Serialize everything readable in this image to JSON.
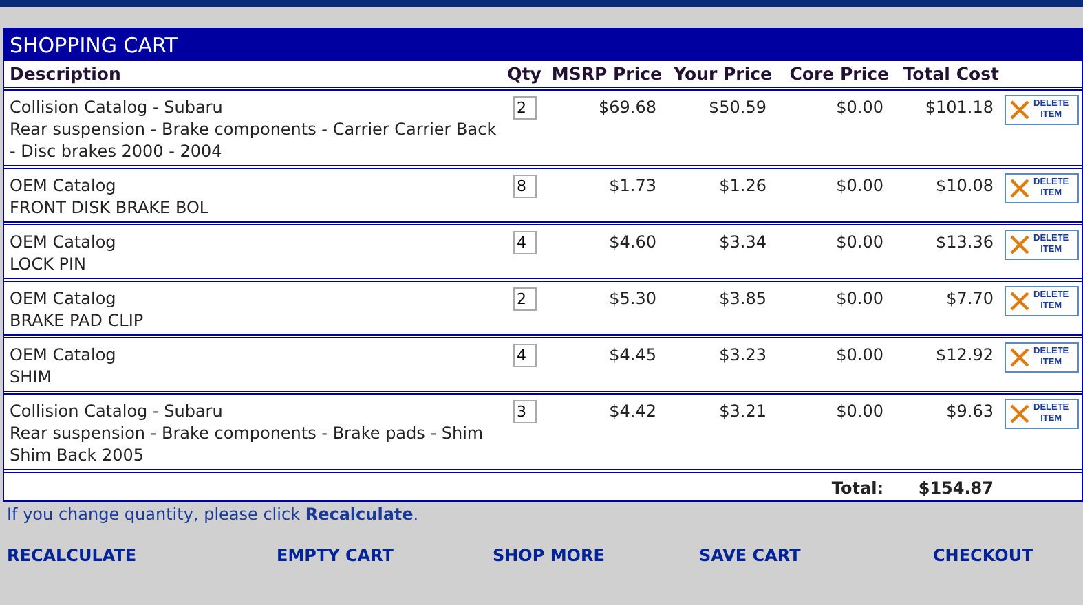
{
  "cart": {
    "title": "SHOPPING CART",
    "columns": [
      "Description",
      "Qty",
      "MSRP Price",
      "Your Price",
      "Core Price",
      "Total Cost"
    ],
    "rows": [
      {
        "description": [
          "Collision Catalog - Subaru",
          "Rear suspension - Brake components - Carrier Carrier Back - Disc brakes 2000 - 2004"
        ],
        "qty": "2",
        "msrp": "$69.68",
        "your_price": "$50.59",
        "core": "$0.00",
        "total": "$101.18",
        "delete": [
          "DELETE",
          "ITEM"
        ]
      },
      {
        "description": [
          "OEM Catalog",
          "FRONT DISK BRAKE BOL"
        ],
        "qty": "8",
        "msrp": "$1.73",
        "your_price": "$1.26",
        "core": "$0.00",
        "total": "$10.08",
        "delete": [
          "DELETE",
          "ITEM"
        ]
      },
      {
        "description": [
          "OEM Catalog",
          "LOCK PIN"
        ],
        "qty": "4",
        "msrp": "$4.60",
        "your_price": "$3.34",
        "core": "$0.00",
        "total": "$13.36",
        "delete": [
          "DELETE",
          "ITEM"
        ]
      },
      {
        "description": [
          "OEM Catalog",
          "BRAKE PAD CLIP"
        ],
        "qty": "2",
        "msrp": "$5.30",
        "your_price": "$3.85",
        "core": "$0.00",
        "total": "$7.70",
        "delete": [
          "DELETE",
          "ITEM"
        ]
      },
      {
        "description": [
          "OEM Catalog",
          "SHIM"
        ],
        "qty": "4",
        "msrp": "$4.45",
        "your_price": "$3.23",
        "core": "$0.00",
        "total": "$12.92",
        "delete": [
          "DELETE",
          "ITEM"
        ]
      },
      {
        "description": [
          "Collision Catalog - Subaru",
          "Rear suspension - Brake components - Brake pads - Shim Shim Back 2005"
        ],
        "qty": "3",
        "msrp": "$4.42",
        "your_price": "$3.21",
        "core": "$0.00",
        "total": "$9.63",
        "delete": [
          "DELETE",
          "ITEM"
        ]
      }
    ],
    "total_label": "Total:",
    "total_value": "$154.87"
  },
  "note": "If you change quantity, please click **Recalculate**.",
  "actions": [
    "RECALCULATE",
    "EMPTY CART",
    "SHOP MORE",
    "SAVE CART",
    "CHECKOUT"
  ]
}
